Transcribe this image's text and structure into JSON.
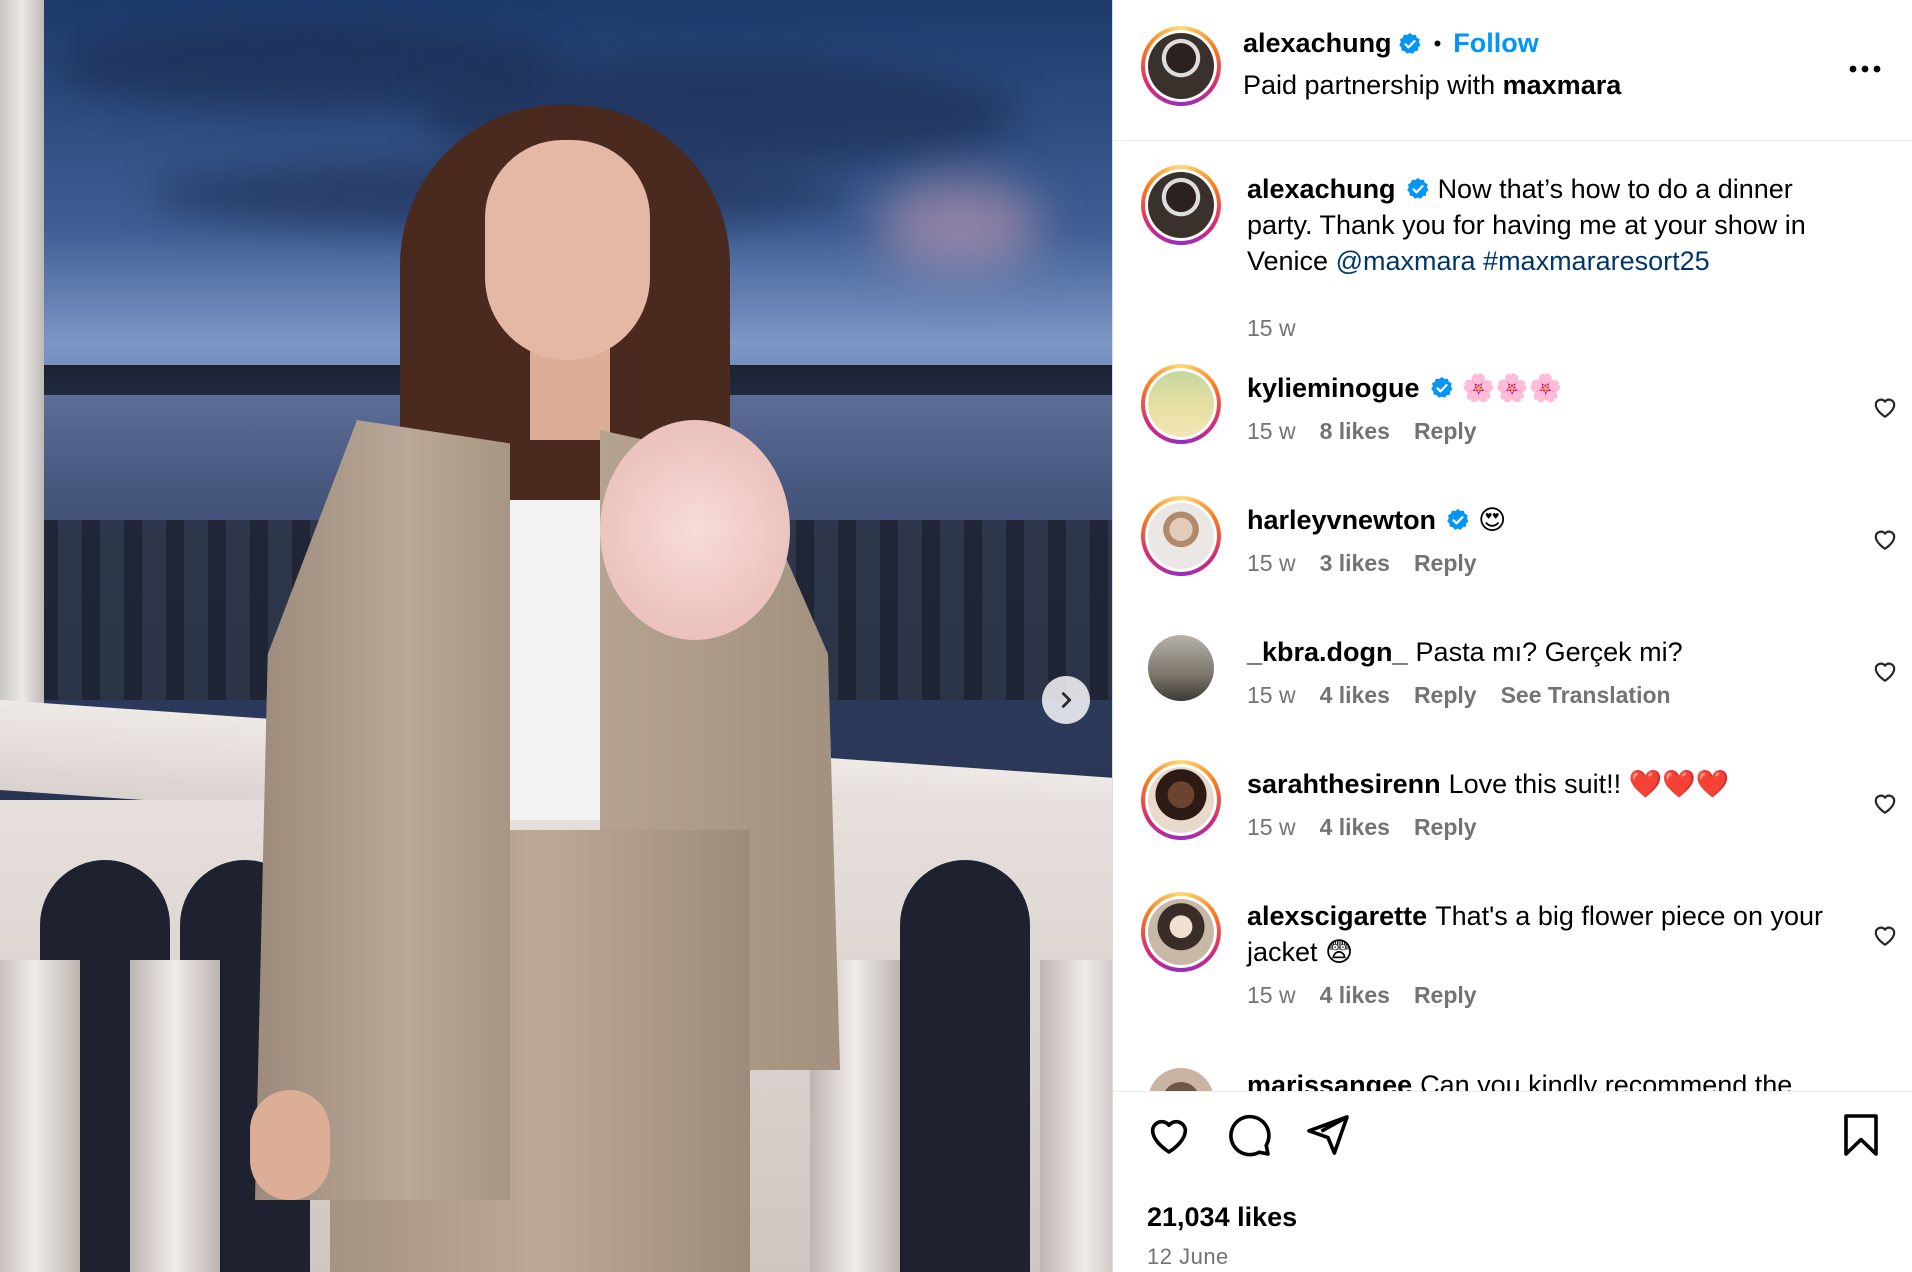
{
  "post": {
    "author": "alexachung",
    "follow_label": "Follow",
    "separator": "•",
    "partnership_prefix": "Paid partnership with ",
    "partner": "maxmara",
    "more_label": "•••",
    "caption_text": "Now that’s how to do a dinner party. Thank you for having me at your show in Venice",
    "caption_mention": "@maxmara",
    "caption_hashtag": "#maxmararesort25",
    "caption_time": "15 w",
    "likes": "21,034 likes",
    "date": "12 June"
  },
  "comments": [
    {
      "user": "kylieminogue",
      "verified": true,
      "text": "🌸🌸🌸",
      "time": "15 w",
      "likes": "8 likes",
      "reply": "Reply"
    },
    {
      "user": "harleyvnewton",
      "verified": true,
      "text": "😍",
      "time": "15 w",
      "likes": "3 likes",
      "reply": "Reply"
    },
    {
      "user": "_kbra.dogn_",
      "verified": false,
      "text": "Pasta mı? Gerçek mi?",
      "time": "15 w",
      "likes": "4 likes",
      "reply": "Reply",
      "translate": "See Translation"
    },
    {
      "user": "sarahthesirenn",
      "verified": false,
      "text": "Love this suit!! ❤️❤️❤️",
      "time": "15 w",
      "likes": "4 likes",
      "reply": "Reply"
    },
    {
      "user": "alexscigarette",
      "verified": false,
      "text": "That's a big flower piece on your jacket 😨",
      "time": "15 w",
      "likes": "4 likes",
      "reply": "Reply"
    },
    {
      "user": "marissangee",
      "verified": false,
      "text": "Can you kindly recommend the"
    }
  ],
  "colors": {
    "accent": "#0095f6",
    "link": "#00376b",
    "muted": "#737373"
  },
  "icons": [
    "verified-badge-icon",
    "heart-icon",
    "comment-icon",
    "share-icon",
    "bookmark-icon",
    "chevron-right-icon",
    "more-icon"
  ]
}
